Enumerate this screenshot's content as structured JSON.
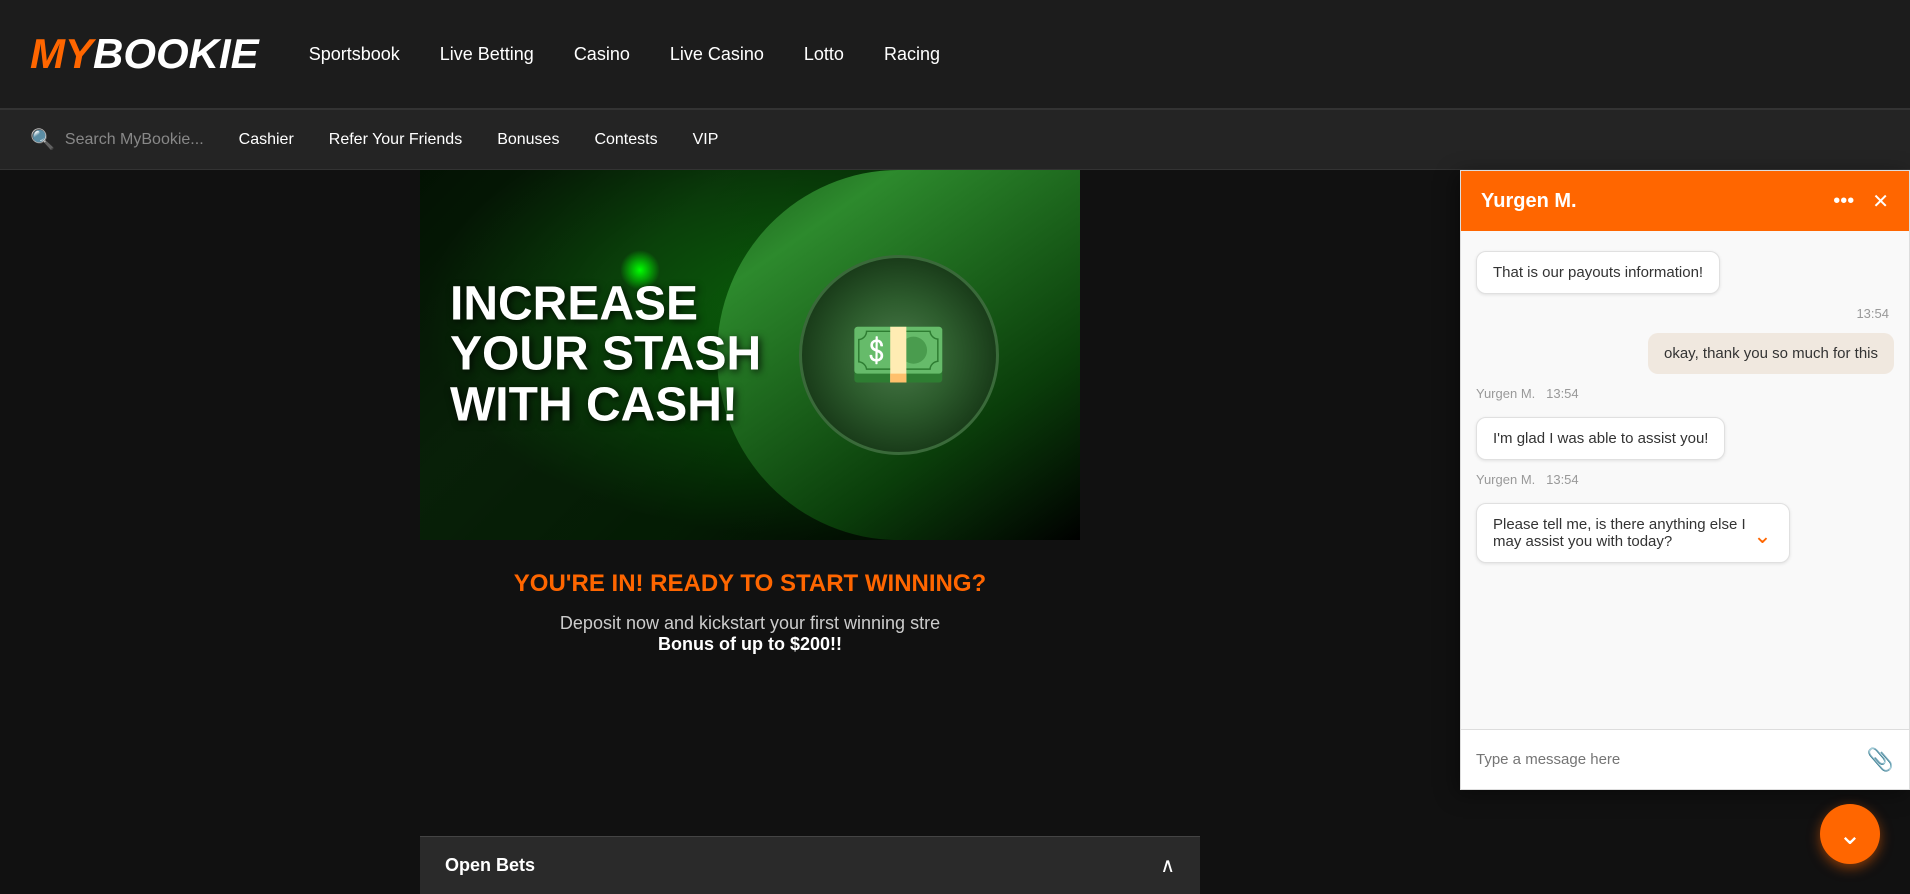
{
  "logo": {
    "my": "MY",
    "bookie": "BOOKIE"
  },
  "top_nav": {
    "links": [
      {
        "label": "Sportsbook",
        "id": "sportsbook"
      },
      {
        "label": "Live Betting",
        "id": "live-betting"
      },
      {
        "label": "Casino",
        "id": "casino"
      },
      {
        "label": "Live Casino",
        "id": "live-casino"
      },
      {
        "label": "Lotto",
        "id": "lotto"
      },
      {
        "label": "Racing",
        "id": "racing"
      }
    ]
  },
  "secondary_nav": {
    "search_placeholder": "Search MyBookie...",
    "links": [
      {
        "label": "Cashier",
        "id": "cashier"
      },
      {
        "label": "Refer Your Friends",
        "id": "refer"
      },
      {
        "label": "Bonuses",
        "id": "bonuses"
      },
      {
        "label": "Contests",
        "id": "contests"
      },
      {
        "label": "VIP",
        "id": "vip"
      }
    ]
  },
  "hero": {
    "line1": "INCREASE",
    "line2": "YOUR STASH",
    "line3": "WITH CASH!"
  },
  "promo": {
    "title": "YOU'RE IN! READY TO START WINNING?",
    "body": "Deposit now and kickstart your first winning stre",
    "bonus": "Bonus of up to $200!!"
  },
  "open_bets": {
    "label": "Open Bets",
    "chevron": "∧"
  },
  "chat": {
    "agent_name": "Yurgen M.",
    "messages": [
      {
        "type": "agent",
        "text": "That is our payouts information!",
        "id": "msg1"
      },
      {
        "type": "timestamp",
        "value": "13:54",
        "id": "ts1"
      },
      {
        "type": "user",
        "text": "okay, thank you so much for this",
        "id": "msg2"
      },
      {
        "type": "agent_meta",
        "sender": "Yurgen M.",
        "time": "13:54",
        "id": "meta1"
      },
      {
        "type": "agent",
        "text": "I'm glad I was able to assist you!",
        "id": "msg3"
      },
      {
        "type": "agent_meta",
        "sender": "Yurgen M.",
        "time": "13:54",
        "id": "meta2"
      },
      {
        "type": "agent",
        "text": "Please tell me, is there anything else I may assist you with today?",
        "id": "msg4"
      }
    ],
    "input_placeholder": "Type a message here",
    "dots_icon": "•••",
    "close_icon": "✕",
    "scroll_down_icon": "⌄",
    "attachment_icon": "📎"
  },
  "floating_button": {
    "chevron": "⌄"
  }
}
